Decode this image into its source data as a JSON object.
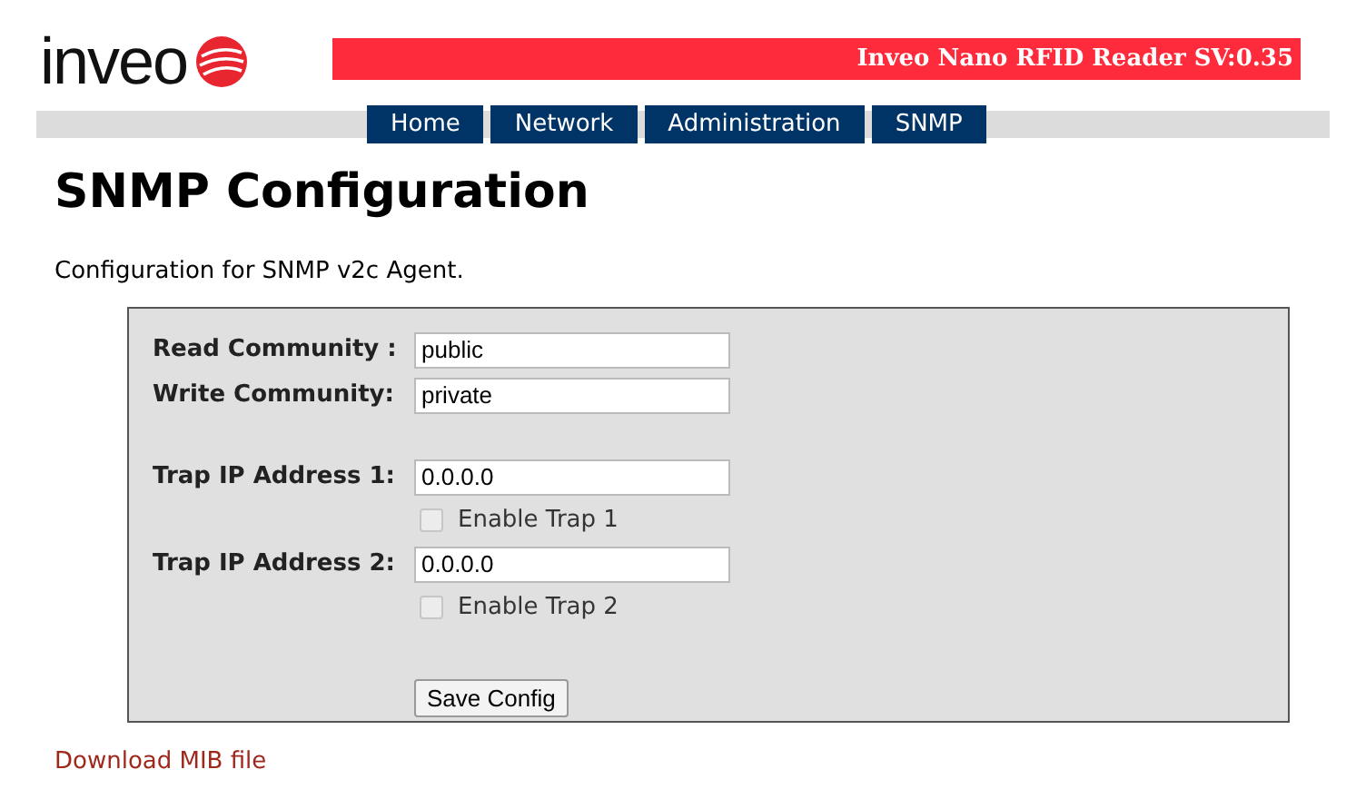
{
  "logo": {
    "text": "inveo"
  },
  "banner": {
    "title": "Inveo Nano RFID Reader SV:0.35"
  },
  "nav": [
    {
      "label": "Home"
    },
    {
      "label": "Network"
    },
    {
      "label": "Administration"
    },
    {
      "label": "SNMP"
    }
  ],
  "page": {
    "title": "SNMP Configuration",
    "description": "Configuration for SNMP v2c Agent."
  },
  "form": {
    "rows": [
      {
        "kind": "field",
        "label": "Read Community :",
        "value": "public"
      },
      {
        "kind": "field",
        "label": "Write Community:",
        "value": "private"
      },
      {
        "kind": "spacer"
      },
      {
        "kind": "field",
        "label": "Trap IP Address 1:",
        "value": "0.0.0.0"
      },
      {
        "kind": "checkbox",
        "label": "Enable Trap 1",
        "checked": false,
        "disabled": true
      },
      {
        "kind": "field",
        "label": "Trap IP Address 2:",
        "value": "0.0.0.0"
      },
      {
        "kind": "checkbox",
        "label": "Enable Trap 2",
        "checked": false,
        "disabled": true
      },
      {
        "kind": "spacer"
      },
      {
        "kind": "button",
        "label": "Save Config"
      }
    ]
  },
  "link": {
    "text": "Download MIB file"
  }
}
